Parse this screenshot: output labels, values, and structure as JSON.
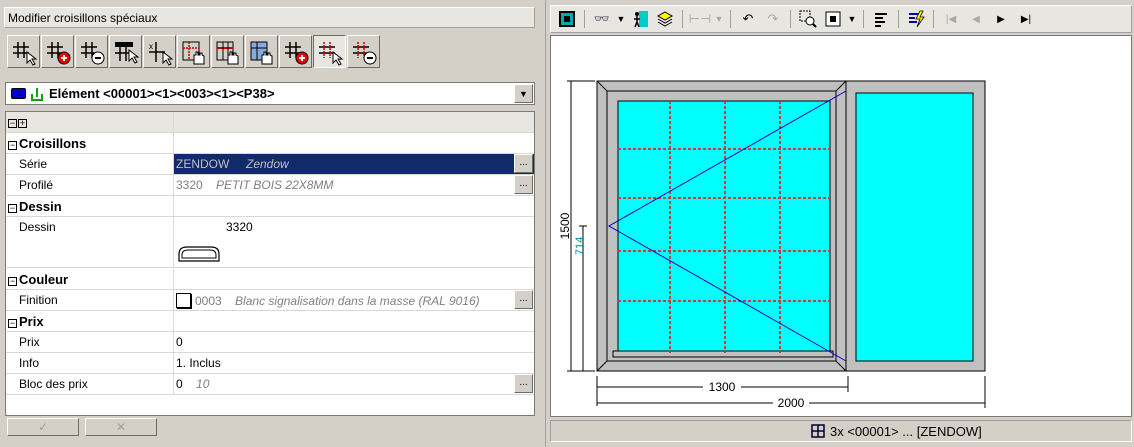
{
  "panel_title": "Modifier croisillons spéciaux",
  "toolbar_icons": [
    "grid-select-icon",
    "grid-add-icon",
    "grid-remove-icon",
    "grid-edit-icon",
    "grid-split-icon",
    "grid-hand-icon",
    "grid-column-icon",
    "grid-move-icon",
    "grid-plus-icon",
    "grid-select-active-icon",
    "grid-minus-icon"
  ],
  "element": {
    "label": "Elément <00001><1><003><1><P38>",
    "swatch_color": "#0000cc"
  },
  "properties": {
    "expand_all": "⊟⊞",
    "croisillons": {
      "title": "Croisillons",
      "serie_label": "Série",
      "serie_code": "ZENDOW",
      "serie_name": "Zendow",
      "profile_label": "Profilé",
      "profile_code": "3320",
      "profile_name": "PETIT BOIS 22X8MM"
    },
    "dessin": {
      "title": "Dessin",
      "label": "Dessin",
      "value": "3320"
    },
    "couleur": {
      "title": "Couleur",
      "finition_label": "Finition",
      "finition_code": "0003",
      "finition_name": "Blanc signalisation dans la masse (RAL 9016)"
    },
    "prix": {
      "title": "Prix",
      "prix_label": "Prix",
      "prix_value": "0",
      "info_label": "Info",
      "info_value": "1. Inclus",
      "bloc_label": "Bloc des prix",
      "bloc_value": "0",
      "bloc_extra": "10"
    }
  },
  "ellipsis": "...",
  "bottom_buttons": {
    "ok": "✓",
    "cancel": "✕"
  },
  "drawing": {
    "dim_height": "1500",
    "dim_sub_height": "714",
    "dim_width_inner": "1300",
    "dim_width_total": "2000",
    "glass_color": "#00ffff",
    "frame_color": "#c0c0c0"
  },
  "status_text": "3x <00001> ... [ZENDOW]"
}
